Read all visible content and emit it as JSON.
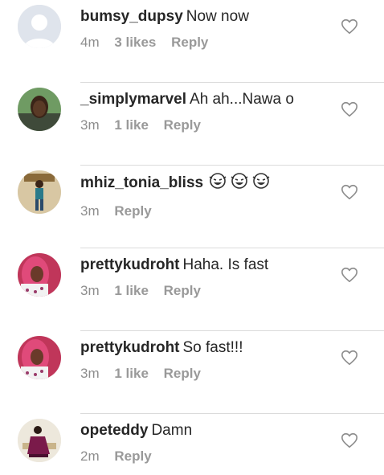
{
  "comments": [
    {
      "username": "bumsy_dupsy",
      "text": "Now now",
      "time": "4m",
      "likes": "3 likes",
      "reply": "Reply",
      "avatar": "default-avatar-icon",
      "avatar_color": "#c9d3e4"
    },
    {
      "username": "_simplymarvel",
      "text": "Ah ah...Nawa o",
      "time": "3m",
      "likes": "1 like",
      "reply": "Reply",
      "avatar": "user-photo",
      "avatar_color": "#7aa36f"
    },
    {
      "username": "mhiz_tonia_bliss",
      "text": "",
      "emoji": [
        "laughing-face-emoji",
        "laughing-face-emoji",
        "laughing-face-emoji"
      ],
      "time": "3m",
      "likes": "",
      "reply": "Reply",
      "avatar": "user-photo",
      "avatar_color": "#b9a27c"
    },
    {
      "username": "prettykudroht",
      "text": "Haha. Is fast",
      "time": "3m",
      "likes": "1 like",
      "reply": "Reply",
      "avatar": "user-photo",
      "avatar_color": "#d9366c"
    },
    {
      "username": "prettykudroht",
      "text": "So fast!!!",
      "time": "3m",
      "likes": "1 like",
      "reply": "Reply",
      "avatar": "user-photo",
      "avatar_color": "#d9366c"
    },
    {
      "username": "opeteddy",
      "text": "Damn",
      "time": "2m",
      "likes": "",
      "reply": "Reply",
      "avatar": "user-photo",
      "avatar_color": "#7a1a4a"
    }
  ],
  "colors": {
    "username": "#262626",
    "meta": "#8e8e8e",
    "divider": "#dbdbdb"
  }
}
